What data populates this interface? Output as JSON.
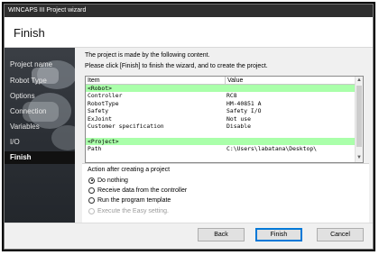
{
  "window": {
    "title": "WINCAPS III Project wizard"
  },
  "header": {
    "title": "Finish"
  },
  "sidebar": {
    "items": [
      {
        "label": "Project name",
        "active": false
      },
      {
        "label": "Robot Type",
        "active": false
      },
      {
        "label": "Options",
        "active": false
      },
      {
        "label": "Connection",
        "active": false
      },
      {
        "label": "Variables",
        "active": false
      },
      {
        "label": "I/O",
        "active": false
      },
      {
        "label": "Finish",
        "active": true
      }
    ]
  },
  "content": {
    "intro_line1": "The project is made by the following content.",
    "intro_line2": "Please click [Finish] to finish the wizard, and to create the project."
  },
  "table": {
    "columns": [
      "Item",
      "Value"
    ],
    "rows": [
      {
        "item": "<Robot>",
        "value": "",
        "group": true
      },
      {
        "item": "Controller",
        "value": "RC8",
        "group": false
      },
      {
        "item": "RobotType",
        "value": "HM-40851 A",
        "group": false
      },
      {
        "item": "Safety",
        "value": "Safety I/O",
        "group": false
      },
      {
        "item": "ExJoint",
        "value": "Not use",
        "group": false
      },
      {
        "item": "Customer specification",
        "value": "Disable",
        "group": false
      },
      {
        "item": "",
        "value": "",
        "group": false
      },
      {
        "item": "<Project>",
        "value": "",
        "group": true
      },
      {
        "item": "Path",
        "value": "C:\\Users\\labatana\\Desktop\\",
        "group": false
      }
    ]
  },
  "actions": {
    "heading": "Action after creating a project",
    "options": [
      {
        "label": "Do nothing",
        "checked": true,
        "disabled": false
      },
      {
        "label": "Receive data from the controller",
        "checked": false,
        "disabled": false
      },
      {
        "label": "Run the program template",
        "checked": false,
        "disabled": false
      },
      {
        "label": "Execute the Easy setting.",
        "checked": false,
        "disabled": true
      }
    ]
  },
  "footer": {
    "back_label": "Back",
    "finish_label": "Finish",
    "cancel_label": "Cancel"
  },
  "colors": {
    "group_row": "#aaffaa",
    "titlebar": "#2f2f2f",
    "sidebar": "#2c3036",
    "primary_border": "#0078d7"
  }
}
